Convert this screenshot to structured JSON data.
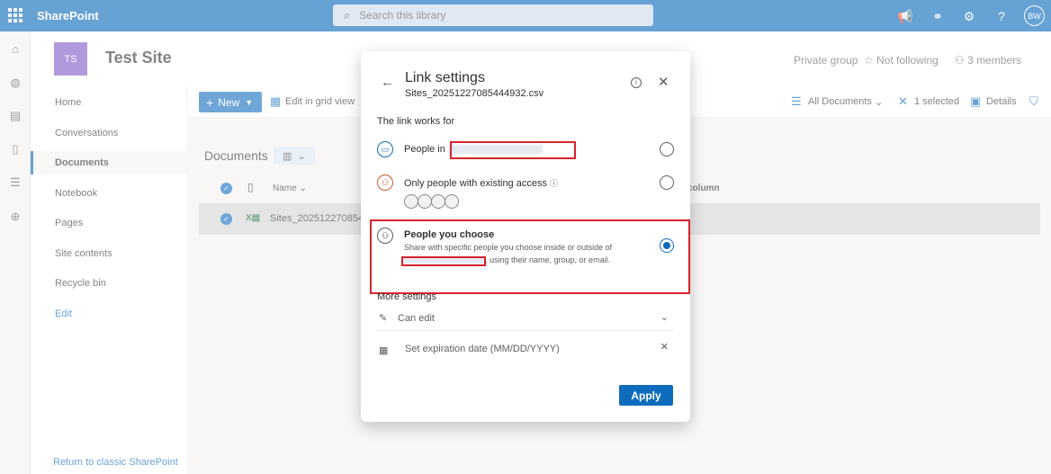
{
  "suitebar": {
    "app_name": "SharePoint",
    "search_placeholder": "Search this library",
    "avatar_initials": "BW"
  },
  "site": {
    "logo_initials": "TS",
    "title": "Test Site",
    "privacy": "Private group",
    "follow_label": "Not following",
    "members_label": "3 members"
  },
  "nav": {
    "items": [
      "Home",
      "Conversations",
      "Documents",
      "Notebook",
      "Pages",
      "Site contents",
      "Recycle bin",
      "Edit"
    ],
    "return_link": "Return to classic SharePoint"
  },
  "commandbar": {
    "new_label": "New",
    "grid_label": "Edit in grid view",
    "view_label": "All Documents",
    "selected_label": "1 selected",
    "details_label": "Details"
  },
  "library": {
    "title": "Documents",
    "columns": {
      "name": "Name",
      "add_column": "column"
    },
    "row_filename": "Sites_2025122708544"
  },
  "dialog": {
    "title": "Link settings",
    "filename": "Sites_20251227085444932.csv",
    "section_label": "The link works for",
    "options": [
      {
        "label": "People in",
        "selected": false
      },
      {
        "label": "Only people with existing access",
        "selected": false
      },
      {
        "label": "People you choose",
        "description_1": "Share with specific people you choose inside or outside of",
        "description_2": ", using their name, group, or email.",
        "selected": true
      }
    ],
    "more_settings_label": "More settings",
    "permission_value": "Can edit",
    "expiration_placeholder": "Set expiration date (MM/DD/YYYY)",
    "apply_label": "Apply"
  },
  "colors": {
    "suitebar": "#0364b8",
    "accent": "#0f6cbd",
    "highlight_box": "#d6242b",
    "site_logo": "#7f56c9"
  }
}
